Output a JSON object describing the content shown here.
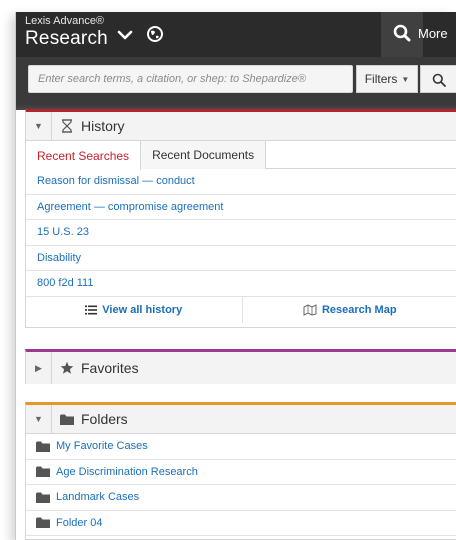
{
  "app": {
    "brand_top": "Lexis Advance®",
    "brand_main": "Research",
    "more_label": "More"
  },
  "search": {
    "placeholder": "Enter search terms, a citation, or shep: to Shepardize®",
    "filters_label": "Filters"
  },
  "history": {
    "title": "History",
    "tabs": [
      {
        "label": "Recent Searches",
        "active": true
      },
      {
        "label": "Recent Documents",
        "active": false
      }
    ],
    "items": [
      "Reason for dismissal — conduct",
      "Agreement — compromise agreement",
      "15 U.S. 23",
      "Disability",
      "800 f2d 111"
    ],
    "view_all_label": "View all history",
    "research_map_label": "Research Map"
  },
  "favorites": {
    "title": "Favorites"
  },
  "folders": {
    "title": "Folders",
    "items": [
      "My Favorite Cases",
      "Age Discrimination Research",
      "Landmark Cases",
      "Folder 04"
    ]
  },
  "colors": {
    "topbar": "#2b2b2b",
    "link": "#1a6fbb",
    "history_accent": "#b3242f",
    "favorites_accent": "#9b3a8e",
    "folders_accent": "#e7962e",
    "active_tab": "#c8202c"
  },
  "icons": {
    "menu": "chevron-down-icon",
    "globe": "globe-icon",
    "search": "search-icon",
    "history": "hourglass-icon",
    "favorites": "star-icon",
    "folders": "folder-icon",
    "list": "list-icon",
    "map": "map-icon"
  }
}
